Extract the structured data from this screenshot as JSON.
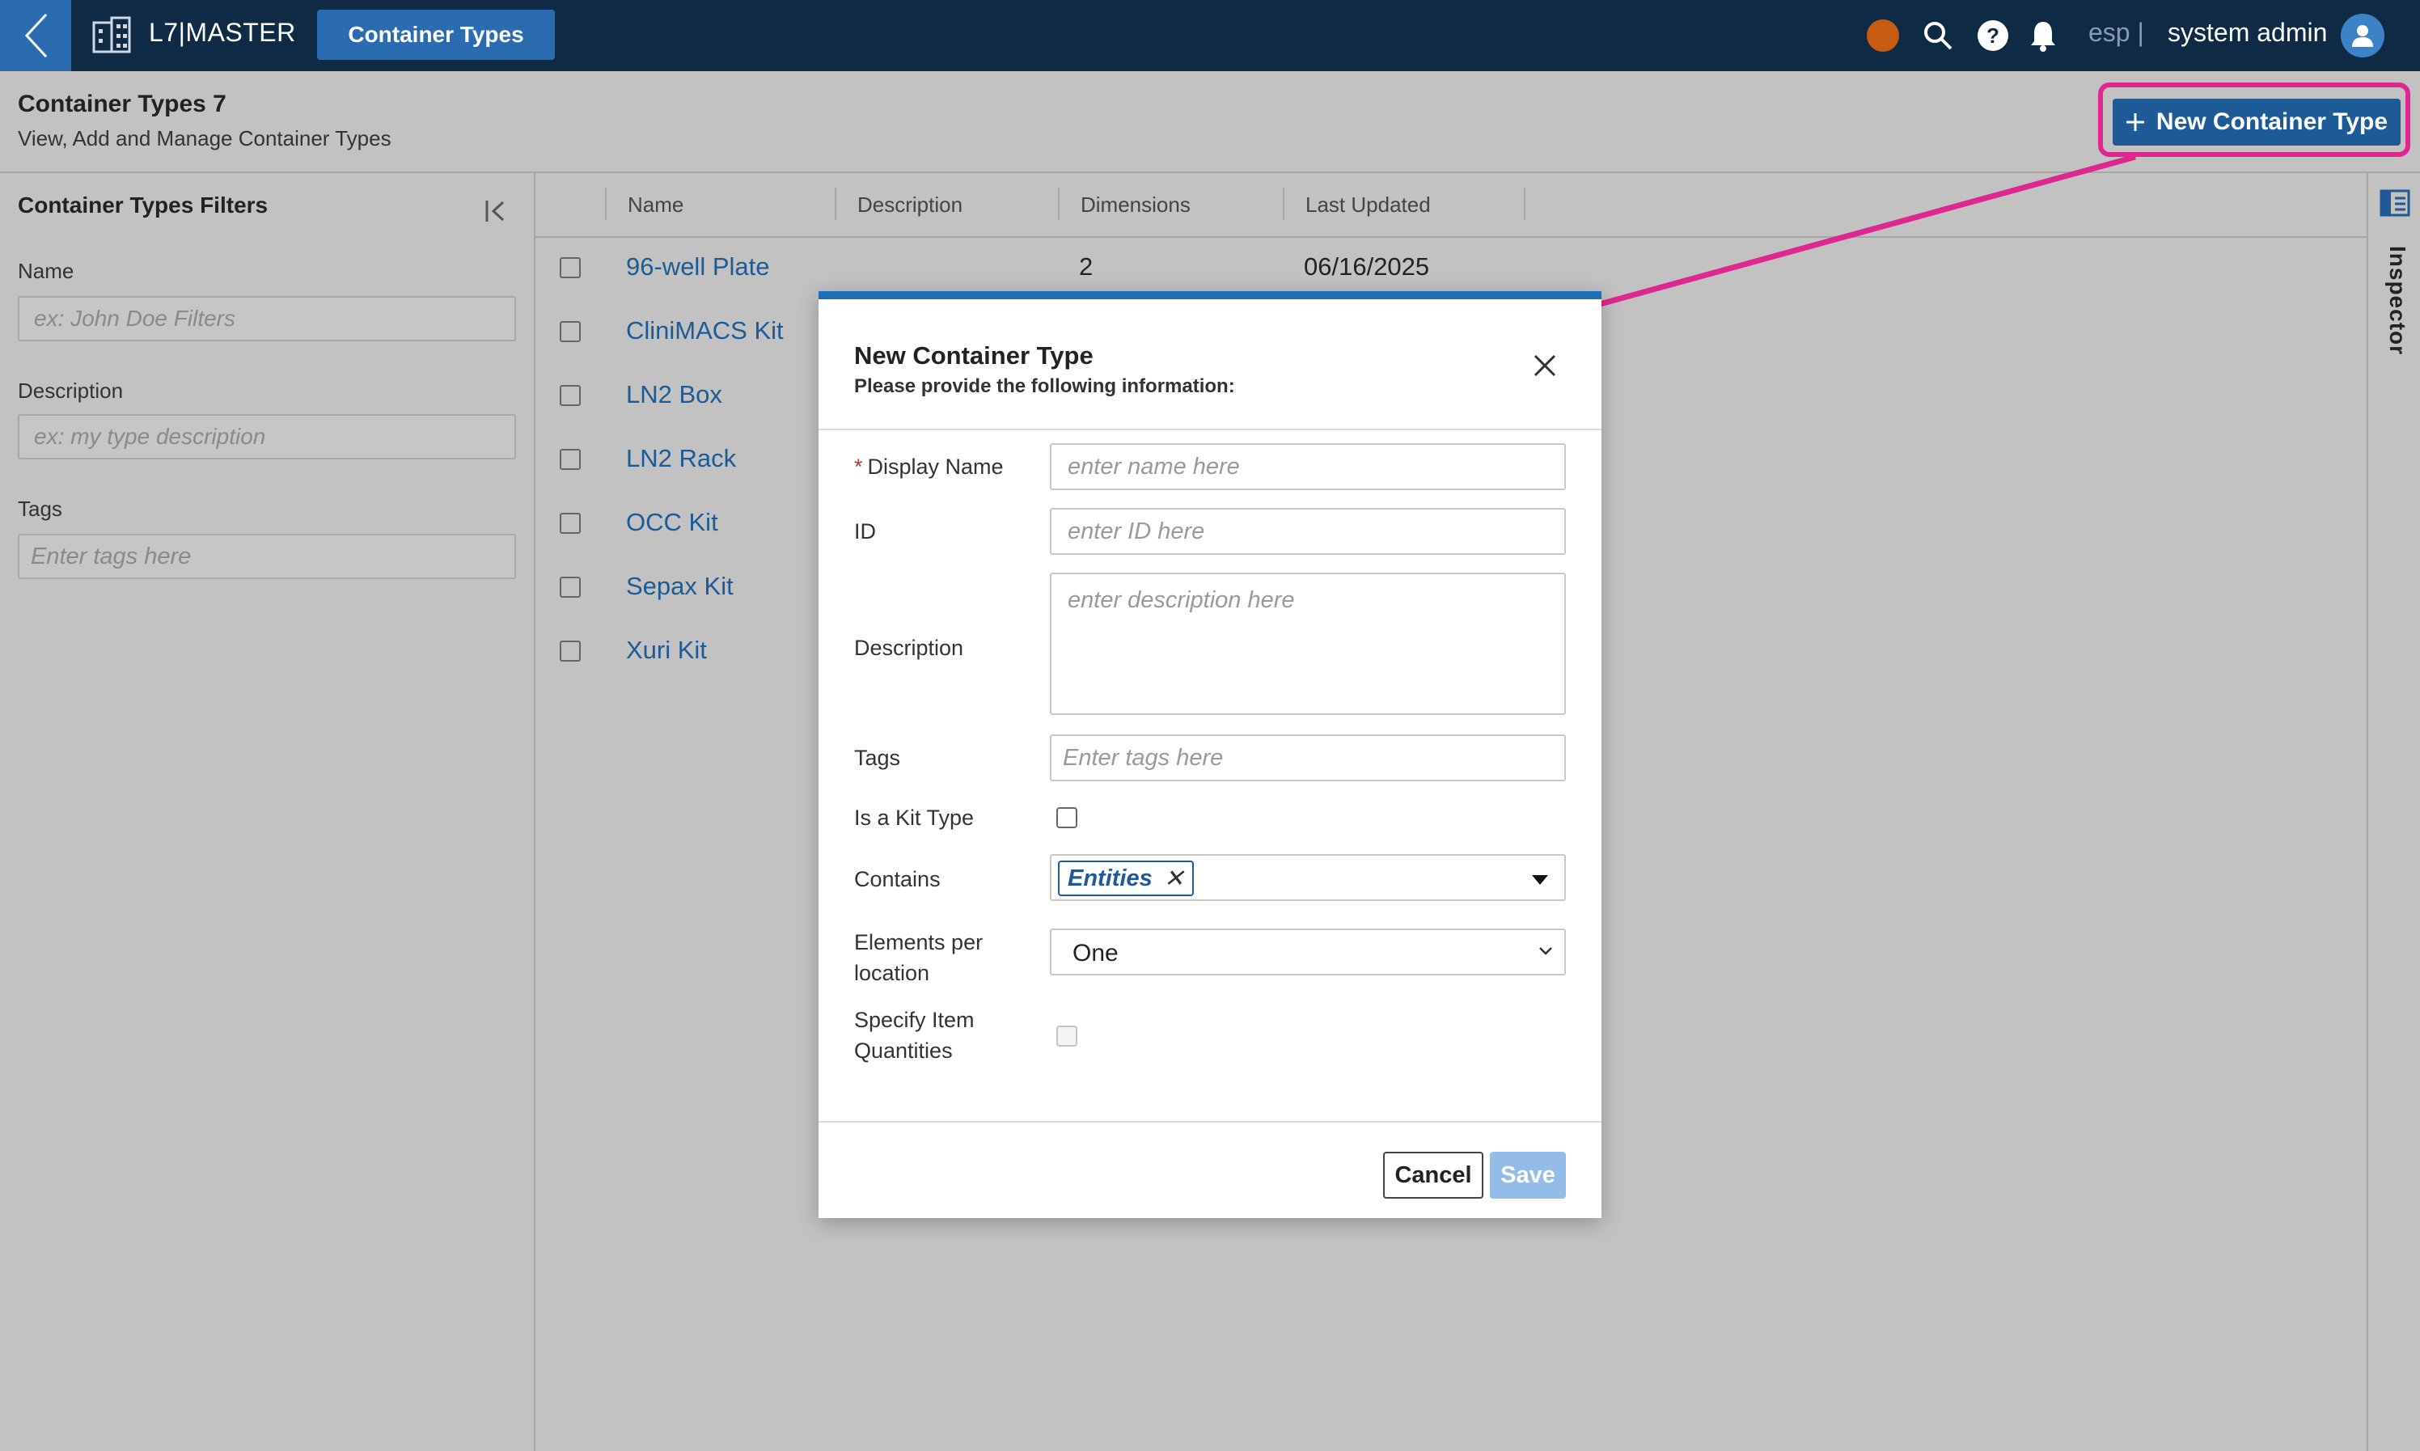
{
  "topbar": {
    "app_name": "L7|MASTER",
    "nav_tab": "Container Types",
    "tenant": "esp |",
    "user": "system admin",
    "status_color": "#c75b12"
  },
  "header": {
    "title": "Container Types 7",
    "subtitle": "View, Add and Manage Container Types",
    "new_button_label": "New Container Type",
    "highlight_color": "#e0268f"
  },
  "filters": {
    "title": "Container Types Filters",
    "fields": [
      {
        "label": "Name",
        "placeholder": "ex: John Doe Filters"
      },
      {
        "label": "Description",
        "placeholder": "ex: my type description"
      },
      {
        "label": "Tags",
        "placeholder": "Enter tags here"
      }
    ]
  },
  "table": {
    "columns": [
      "Name",
      "Description",
      "Dimensions",
      "Last Updated"
    ],
    "rows": [
      {
        "name": "96-well Plate",
        "dimensions": "2",
        "last_updated": "06/16/2025"
      },
      {
        "name": "CliniMACS Kit",
        "dimensions": "",
        "last_updated": ""
      },
      {
        "name": "LN2 Box",
        "dimensions": "",
        "last_updated": ""
      },
      {
        "name": "LN2 Rack",
        "dimensions": "",
        "last_updated": ""
      },
      {
        "name": "OCC Kit",
        "dimensions": "",
        "last_updated": ""
      },
      {
        "name": "Sepax Kit",
        "dimensions": "",
        "last_updated": ""
      },
      {
        "name": "Xuri Kit",
        "dimensions": "",
        "last_updated": ""
      }
    ]
  },
  "inspector": {
    "label": "Inspector"
  },
  "modal": {
    "title": "New Container Type",
    "subtitle": "Please provide the following information:",
    "fields": {
      "display_name": {
        "label": "Display Name",
        "required_mark": "*",
        "placeholder": "enter name here"
      },
      "id": {
        "label": "ID",
        "placeholder": "enter ID here"
      },
      "description": {
        "label": "Description",
        "placeholder": "enter description here"
      },
      "tags": {
        "label": "Tags",
        "placeholder": "Enter tags here"
      },
      "is_kit": {
        "label": "Is a Kit Type"
      },
      "contains": {
        "label": "Contains",
        "chip": "Entities"
      },
      "elements_per_location": {
        "label_line1": "Elements per",
        "label_line2": "location",
        "value": "One"
      },
      "specify_quantities": {
        "label_line1": "Specify Item",
        "label_line2": "Quantities"
      }
    },
    "cancel_label": "Cancel",
    "save_label": "Save"
  }
}
